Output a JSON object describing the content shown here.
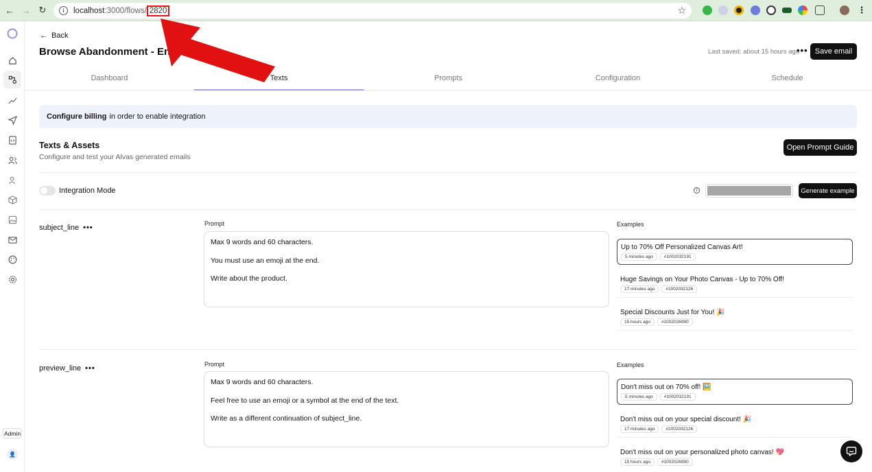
{
  "browser": {
    "url_base": "localhost",
    "url_rest": ":3000/flows/",
    "url_highlight": "2820"
  },
  "sidebar": {
    "admin_badge": "Admin"
  },
  "header": {
    "back_label": "Back",
    "title": "Browse Abandonment - English",
    "last_saved": "Last saved: about 15 hours ago",
    "more_dots": "•••",
    "save_label": "Save email"
  },
  "tabs": [
    {
      "label": "Dashboard"
    },
    {
      "label": "Texts"
    },
    {
      "label": "Prompts"
    },
    {
      "label": "Configuration"
    },
    {
      "label": "Schedule"
    }
  ],
  "banner": {
    "bold": "Configure billing",
    "rest": "in order to enable integration"
  },
  "section": {
    "title": "Texts & Assets",
    "subtitle": "Configure and test your Alvas generated emails",
    "guide_label": "Open Prompt Guide"
  },
  "integration": {
    "label": "Integration Mode",
    "generate_label": "Generate example"
  },
  "fields": [
    {
      "name": "subject_line",
      "dots": "•••",
      "prompt_label": "Prompt",
      "examples_label": "Examples",
      "prompt_lines": [
        "Max 9 words and 60 characters.",
        "You must use an emoji at the end.",
        "Write about the product."
      ],
      "examples": [
        {
          "text": "Up to 70% Off Personalized Canvas Art!",
          "time": "5 minutes ago",
          "id": "#1002032191"
        },
        {
          "text": "Huge Savings on Your Photo Canvas - Up to 70% Off!",
          "time": "17 minutes ago",
          "id": "#1002032126"
        },
        {
          "text": "Special Discounts Just for You! 🎉",
          "time": "15 hours ago",
          "id": "#1002026990"
        }
      ]
    },
    {
      "name": "preview_line",
      "dots": "•••",
      "prompt_label": "Prompt",
      "examples_label": "Examples",
      "prompt_lines": [
        "Max 9 words and 60 characters.",
        "Feel free to use an emoji or a symbol at the end of the text.",
        "Write as a different continuation of subject_line."
      ],
      "examples": [
        {
          "text": "Don't miss out on 70% off! 🖼️",
          "time": "5 minutes ago",
          "id": "#1002032191"
        },
        {
          "text": "Don't miss out on your special discount! 🎉",
          "time": "17 minutes ago",
          "id": "#1002032126"
        },
        {
          "text": "Don't miss out on your personalized photo canvas! 💖",
          "time": "15 hours ago",
          "id": "#1002026990"
        }
      ]
    }
  ],
  "colors": {
    "accent_tab": "#a99de8",
    "annotation": "#e11111",
    "button": "#111111",
    "banner_bg": "#eef2fb"
  }
}
